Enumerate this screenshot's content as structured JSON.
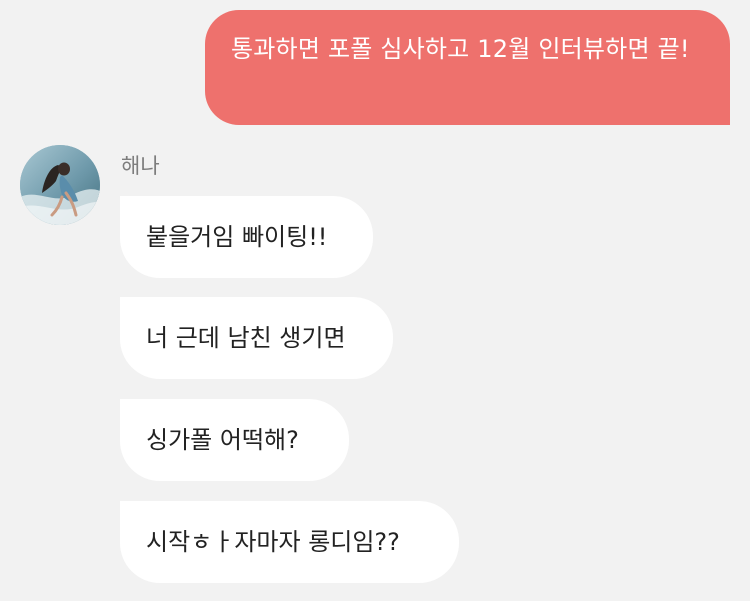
{
  "conversation": {
    "outgoing": [
      {
        "text": "통과하면 포폴 심사하고 12월 인터뷰하면 끝!"
      }
    ],
    "incoming_sender": {
      "name": "해나",
      "avatar_icon": "profile-photo-surfer"
    },
    "incoming": [
      {
        "text": "붙을거임 빠이팅!!"
      },
      {
        "text": "너 근데 남친 생기면"
      },
      {
        "text": "싱가폴 어떡해?"
      },
      {
        "text": "시작ㅎㅏ자마자 롱디임??"
      }
    ]
  },
  "colors": {
    "background": "#f2f2f2",
    "outgoing_bubble": "#ee716d",
    "outgoing_text": "#ffffff",
    "incoming_bubble": "#ffffff",
    "incoming_text": "#222222",
    "sender_name": "#7d7d7d"
  }
}
